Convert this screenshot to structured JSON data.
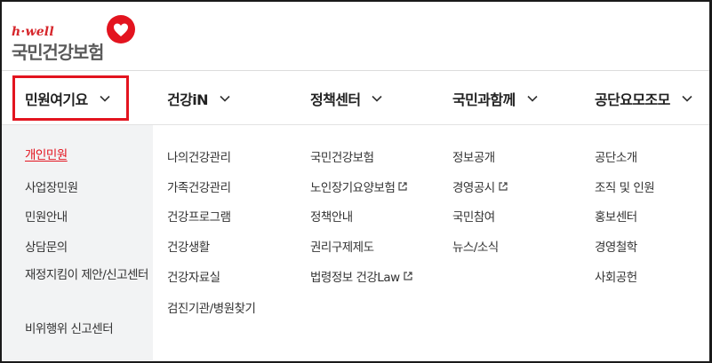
{
  "logo": {
    "tagline": "h·well",
    "name": "국민건강보험"
  },
  "nav": [
    {
      "label": "민원여기요"
    },
    {
      "label": "건강iN"
    },
    {
      "label": "정책센터"
    },
    {
      "label": "국민과함께"
    },
    {
      "label": "공단요모조모"
    }
  ],
  "menus": {
    "civil": [
      "개인민원",
      "사업장민원",
      "민원안내",
      "상담문의",
      "재정지킴이 제안/신고센터",
      "비위행위 신고센터"
    ],
    "health": [
      "나의건강관리",
      "가족건강관리",
      "건강프로그램",
      "건강생활",
      "건강자료실",
      "검진기관/병원찾기"
    ],
    "policy": [
      "국민건강보험",
      "노인장기요양보험",
      "정책안내",
      "권리구제제도",
      "법령정보 건강Law"
    ],
    "together": [
      "정보공개",
      "경영공시",
      "국민참여",
      "뉴스/소식"
    ],
    "about": [
      "공단소개",
      "조직 및 인원",
      "홍보센터",
      "경영철학",
      "사회공헌"
    ]
  },
  "colors": {
    "accent": "#e3141f",
    "panel": "#f2f3f4",
    "text": "#222222"
  },
  "icons": {
    "chevron": "chevron-down-icon",
    "external": "external-link-icon",
    "logo": "heart-logo-icon"
  }
}
